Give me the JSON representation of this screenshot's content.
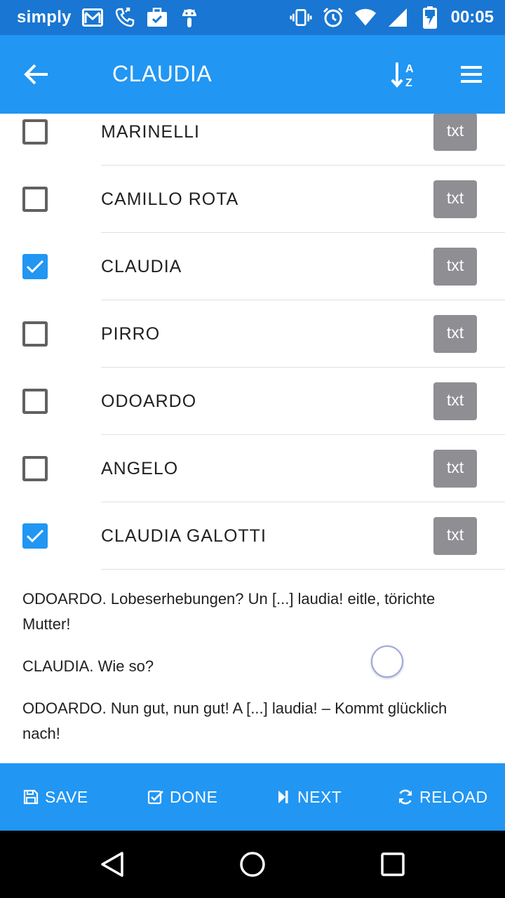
{
  "status_bar": {
    "carrier": "simply",
    "time": "00:05",
    "left_icons": [
      "gmail-icon",
      "phone-call-icon",
      "briefcase-check-icon",
      "android-icon"
    ],
    "right_icons": [
      "vibrate-icon",
      "alarm-icon",
      "wifi-icon",
      "signal-icon",
      "battery-charging-icon"
    ]
  },
  "app_bar": {
    "title": "CLAUDIA",
    "back_icon": "arrow-left-icon",
    "sort_icon": "sort-az-icon",
    "menu_icon": "hamburger-menu-icon"
  },
  "list": {
    "items": [
      {
        "label": "MARINELLI",
        "checked": false,
        "button": "txt"
      },
      {
        "label": "CAMILLO ROTA",
        "checked": false,
        "button": "txt"
      },
      {
        "label": "CLAUDIA",
        "checked": true,
        "button": "txt"
      },
      {
        "label": "PIRRO",
        "checked": false,
        "button": "txt"
      },
      {
        "label": "ODOARDO",
        "checked": false,
        "button": "txt"
      },
      {
        "label": "ANGELO",
        "checked": false,
        "button": "txt"
      },
      {
        "label": "CLAUDIA GALOTTI",
        "checked": true,
        "button": "txt"
      }
    ]
  },
  "preview": {
    "lines": [
      "ODOARDO. Lobeserhebungen? Un [...] laudia! eitle, törichte Mutter!",
      "CLAUDIA. Wie so?",
      "ODOARDO. Nun gut, nun gut! A [...] laudia! – Kommt glücklich nach!"
    ]
  },
  "bottom_bar": {
    "save": "SAVE",
    "done": "DONE",
    "next": "NEXT",
    "reload": "RELOAD"
  },
  "colors": {
    "status_bar": "#1976d2",
    "app_bar": "#2196f3",
    "checkbox_checked": "#2196f3",
    "txt_button": "#8e8e93"
  }
}
